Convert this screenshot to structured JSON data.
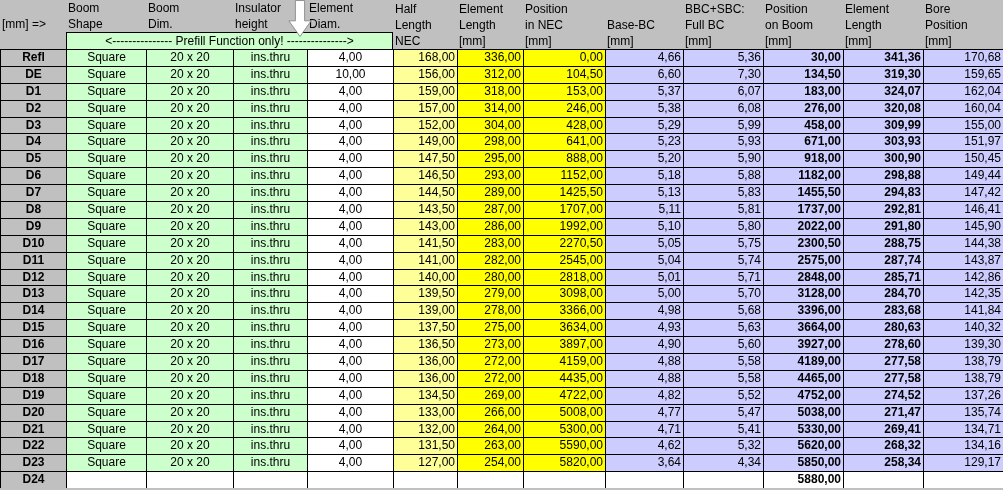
{
  "corner_label": "[mm] =>",
  "columns": [
    {
      "lines": [
        "Boom",
        "Shape"
      ]
    },
    {
      "lines": [
        "Boom",
        "Dim."
      ]
    },
    {
      "lines": [
        "Insulator",
        "height"
      ]
    },
    {
      "lines": [
        "Element",
        "Diam."
      ]
    },
    {
      "lines": [
        "Half",
        "Length",
        "NEC"
      ]
    },
    {
      "lines": [
        "Element",
        "Length",
        "[mm]"
      ]
    },
    {
      "lines": [
        "Position",
        "in NEC",
        "[mm]"
      ]
    },
    {
      "lines": [
        "Base-BC",
        "[mm]"
      ]
    },
    {
      "lines": [
        "BBC+SBC:",
        "Full BC",
        "[mm]"
      ]
    },
    {
      "lines": [
        "Position",
        "on Boom",
        "[mm]"
      ]
    },
    {
      "lines": [
        "Element",
        "Length",
        "[mm]"
      ]
    },
    {
      "lines": [
        "Bore",
        "Position",
        "[mm]"
      ]
    }
  ],
  "prefill_note": "<--------------- Prefill Function only! --------------->",
  "rows": [
    {
      "label": "Refl",
      "shape": "Square",
      "dim": "20 x 20",
      "insulator": "ins.thru",
      "diam": "4,00",
      "half": "168,00",
      "length": "336,00",
      "pos_nec": "0,00",
      "base_bc": "4,66",
      "full_bc": "5,36",
      "pos_boom": "30,00",
      "elem_len": "341,36",
      "bore": "170,68"
    },
    {
      "label": "DE",
      "shape": "Square",
      "dim": "20 x 20",
      "insulator": "ins.thru",
      "diam": "10,00",
      "half": "156,00",
      "length": "312,00",
      "pos_nec": "104,50",
      "base_bc": "6,60",
      "full_bc": "7,30",
      "pos_boom": "134,50",
      "elem_len": "319,30",
      "bore": "159,65"
    },
    {
      "label": "D1",
      "shape": "Square",
      "dim": "20 x 20",
      "insulator": "ins.thru",
      "diam": "4,00",
      "half": "159,00",
      "length": "318,00",
      "pos_nec": "153,00",
      "base_bc": "5,37",
      "full_bc": "6,07",
      "pos_boom": "183,00",
      "elem_len": "324,07",
      "bore": "162,04"
    },
    {
      "label": "D2",
      "shape": "Square",
      "dim": "20 x 20",
      "insulator": "ins.thru",
      "diam": "4,00",
      "half": "157,00",
      "length": "314,00",
      "pos_nec": "246,00",
      "base_bc": "5,38",
      "full_bc": "6,08",
      "pos_boom": "276,00",
      "elem_len": "320,08",
      "bore": "160,04"
    },
    {
      "label": "D3",
      "shape": "Square",
      "dim": "20 x 20",
      "insulator": "ins.thru",
      "diam": "4,00",
      "half": "152,00",
      "length": "304,00",
      "pos_nec": "428,00",
      "base_bc": "5,29",
      "full_bc": "5,99",
      "pos_boom": "458,00",
      "elem_len": "309,99",
      "bore": "155,00"
    },
    {
      "label": "D4",
      "shape": "Square",
      "dim": "20 x 20",
      "insulator": "ins.thru",
      "diam": "4,00",
      "half": "149,00",
      "length": "298,00",
      "pos_nec": "641,00",
      "base_bc": "5,23",
      "full_bc": "5,93",
      "pos_boom": "671,00",
      "elem_len": "303,93",
      "bore": "151,97"
    },
    {
      "label": "D5",
      "shape": "Square",
      "dim": "20 x 20",
      "insulator": "ins.thru",
      "diam": "4,00",
      "half": "147,50",
      "length": "295,00",
      "pos_nec": "888,00",
      "base_bc": "5,20",
      "full_bc": "5,90",
      "pos_boom": "918,00",
      "elem_len": "300,90",
      "bore": "150,45"
    },
    {
      "label": "D6",
      "shape": "Square",
      "dim": "20 x 20",
      "insulator": "ins.thru",
      "diam": "4,00",
      "half": "146,50",
      "length": "293,00",
      "pos_nec": "1152,00",
      "base_bc": "5,18",
      "full_bc": "5,88",
      "pos_boom": "1182,00",
      "elem_len": "298,88",
      "bore": "149,44"
    },
    {
      "label": "D7",
      "shape": "Square",
      "dim": "20 x 20",
      "insulator": "ins.thru",
      "diam": "4,00",
      "half": "144,50",
      "length": "289,00",
      "pos_nec": "1425,50",
      "base_bc": "5,13",
      "full_bc": "5,83",
      "pos_boom": "1455,50",
      "elem_len": "294,83",
      "bore": "147,42"
    },
    {
      "label": "D8",
      "shape": "Square",
      "dim": "20 x 20",
      "insulator": "ins.thru",
      "diam": "4,00",
      "half": "143,50",
      "length": "287,00",
      "pos_nec": "1707,00",
      "base_bc": "5,11",
      "full_bc": "5,81",
      "pos_boom": "1737,00",
      "elem_len": "292,81",
      "bore": "146,41"
    },
    {
      "label": "D9",
      "shape": "Square",
      "dim": "20 x 20",
      "insulator": "ins.thru",
      "diam": "4,00",
      "half": "143,00",
      "length": "286,00",
      "pos_nec": "1992,00",
      "base_bc": "5,10",
      "full_bc": "5,80",
      "pos_boom": "2022,00",
      "elem_len": "291,80",
      "bore": "145,90"
    },
    {
      "label": "D10",
      "shape": "Square",
      "dim": "20 x 20",
      "insulator": "ins.thru",
      "diam": "4,00",
      "half": "141,50",
      "length": "283,00",
      "pos_nec": "2270,50",
      "base_bc": "5,05",
      "full_bc": "5,75",
      "pos_boom": "2300,50",
      "elem_len": "288,75",
      "bore": "144,38"
    },
    {
      "label": "D11",
      "shape": "Square",
      "dim": "20 x 20",
      "insulator": "ins.thru",
      "diam": "4,00",
      "half": "141,00",
      "length": "282,00",
      "pos_nec": "2545,00",
      "base_bc": "5,04",
      "full_bc": "5,74",
      "pos_boom": "2575,00",
      "elem_len": "287,74",
      "bore": "143,87"
    },
    {
      "label": "D12",
      "shape": "Square",
      "dim": "20 x 20",
      "insulator": "ins.thru",
      "diam": "4,00",
      "half": "140,00",
      "length": "280,00",
      "pos_nec": "2818,00",
      "base_bc": "5,01",
      "full_bc": "5,71",
      "pos_boom": "2848,00",
      "elem_len": "285,71",
      "bore": "142,86"
    },
    {
      "label": "D13",
      "shape": "Square",
      "dim": "20 x 20",
      "insulator": "ins.thru",
      "diam": "4,00",
      "half": "139,50",
      "length": "279,00",
      "pos_nec": "3098,00",
      "base_bc": "5,00",
      "full_bc": "5,70",
      "pos_boom": "3128,00",
      "elem_len": "284,70",
      "bore": "142,35"
    },
    {
      "label": "D14",
      "shape": "Square",
      "dim": "20 x 20",
      "insulator": "ins.thru",
      "diam": "4,00",
      "half": "139,00",
      "length": "278,00",
      "pos_nec": "3366,00",
      "base_bc": "4,98",
      "full_bc": "5,68",
      "pos_boom": "3396,00",
      "elem_len": "283,68",
      "bore": "141,84"
    },
    {
      "label": "D15",
      "shape": "Square",
      "dim": "20 x 20",
      "insulator": "ins.thru",
      "diam": "4,00",
      "half": "137,50",
      "length": "275,00",
      "pos_nec": "3634,00",
      "base_bc": "4,93",
      "full_bc": "5,63",
      "pos_boom": "3664,00",
      "elem_len": "280,63",
      "bore": "140,32"
    },
    {
      "label": "D16",
      "shape": "Square",
      "dim": "20 x 20",
      "insulator": "ins.thru",
      "diam": "4,00",
      "half": "136,50",
      "length": "273,00",
      "pos_nec": "3897,00",
      "base_bc": "4,90",
      "full_bc": "5,60",
      "pos_boom": "3927,00",
      "elem_len": "278,60",
      "bore": "139,30"
    },
    {
      "label": "D17",
      "shape": "Square",
      "dim": "20 x 20",
      "insulator": "ins.thru",
      "diam": "4,00",
      "half": "136,00",
      "length": "272,00",
      "pos_nec": "4159,00",
      "base_bc": "4,88",
      "full_bc": "5,58",
      "pos_boom": "4189,00",
      "elem_len": "277,58",
      "bore": "138,79"
    },
    {
      "label": "D18",
      "shape": "Square",
      "dim": "20 x 20",
      "insulator": "ins.thru",
      "diam": "4,00",
      "half": "136,00",
      "length": "272,00",
      "pos_nec": "4435,00",
      "base_bc": "4,88",
      "full_bc": "5,58",
      "pos_boom": "4465,00",
      "elem_len": "277,58",
      "bore": "138,79"
    },
    {
      "label": "D19",
      "shape": "Square",
      "dim": "20 x 20",
      "insulator": "ins.thru",
      "diam": "4,00",
      "half": "134,50",
      "length": "269,00",
      "pos_nec": "4722,00",
      "base_bc": "4,82",
      "full_bc": "5,52",
      "pos_boom": "4752,00",
      "elem_len": "274,52",
      "bore": "137,26"
    },
    {
      "label": "D20",
      "shape": "Square",
      "dim": "20 x 20",
      "insulator": "ins.thru",
      "diam": "4,00",
      "half": "133,00",
      "length": "266,00",
      "pos_nec": "5008,00",
      "base_bc": "4,77",
      "full_bc": "5,47",
      "pos_boom": "5038,00",
      "elem_len": "271,47",
      "bore": "135,74"
    },
    {
      "label": "D21",
      "shape": "Square",
      "dim": "20 x 20",
      "insulator": "ins.thru",
      "diam": "4,00",
      "half": "132,00",
      "length": "264,00",
      "pos_nec": "5300,00",
      "base_bc": "4,71",
      "full_bc": "5,41",
      "pos_boom": "5330,00",
      "elem_len": "269,41",
      "bore": "134,71"
    },
    {
      "label": "D22",
      "shape": "Square",
      "dim": "20 x 20",
      "insulator": "ins.thru",
      "diam": "4,00",
      "half": "131,50",
      "length": "263,00",
      "pos_nec": "5590,00",
      "base_bc": "4,62",
      "full_bc": "5,32",
      "pos_boom": "5620,00",
      "elem_len": "268,32",
      "bore": "134,16"
    },
    {
      "label": "D23",
      "shape": "Square",
      "dim": "20 x 20",
      "insulator": "ins.thru",
      "diam": "4,00",
      "half": "127,00",
      "length": "254,00",
      "pos_nec": "5820,00",
      "base_bc": "3,64",
      "full_bc": "4,34",
      "pos_boom": "5850,00",
      "elem_len": "258,34",
      "bore": "129,17"
    },
    {
      "label": "D24",
      "pos_boom": "5880,00"
    }
  ]
}
